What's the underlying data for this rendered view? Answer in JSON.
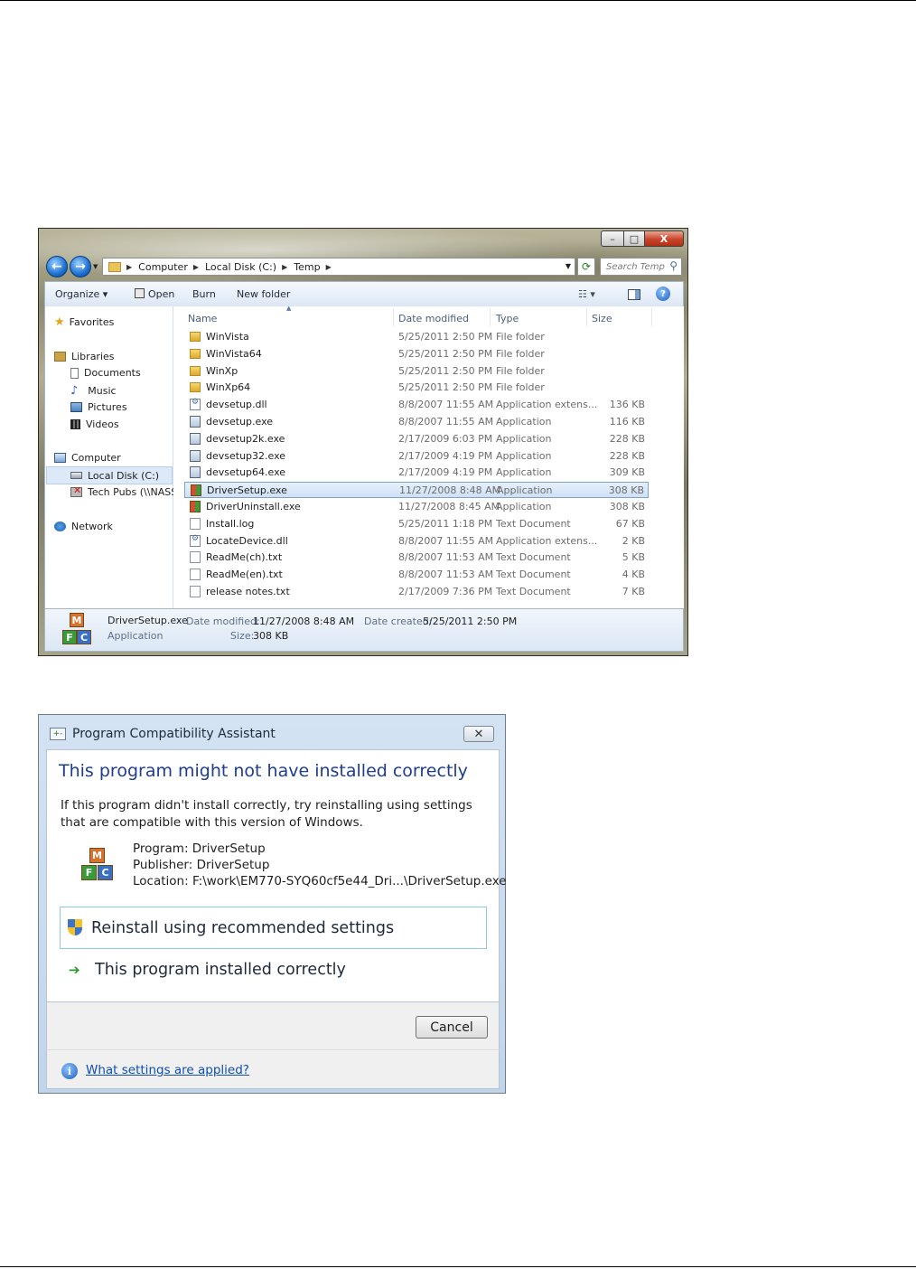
{
  "explorer": {
    "window_controls": {
      "minimize": "–",
      "maximize": "□",
      "close": "X"
    },
    "address": {
      "crumbs": [
        "Computer",
        "Local Disk (C:)",
        "Temp"
      ],
      "search_placeholder": "Search Temp"
    },
    "toolbar": {
      "organize": "Organize ▾",
      "open": "Open",
      "burn": "Burn",
      "new_folder": "New folder"
    },
    "nav": {
      "favorites": "Favorites",
      "libraries": "Libraries",
      "documents": "Documents",
      "music": "Music",
      "pictures": "Pictures",
      "videos": "Videos",
      "computer": "Computer",
      "local_disk": "Local Disk (C:)",
      "tech_pubs": "Tech Pubs (\\\\NASSE",
      "network": "Network"
    },
    "columns": {
      "name": "Name",
      "date": "Date modified",
      "type": "Type",
      "size": "Size"
    },
    "files": [
      {
        "name": "WinVista",
        "date": "5/25/2011 2:50 PM",
        "type": "File folder",
        "size": "",
        "icon": "folder-icon"
      },
      {
        "name": "WinVista64",
        "date": "5/25/2011 2:50 PM",
        "type": "File folder",
        "size": "",
        "icon": "folder-icon"
      },
      {
        "name": "WinXp",
        "date": "5/25/2011 2:50 PM",
        "type": "File folder",
        "size": "",
        "icon": "folder-icon"
      },
      {
        "name": "WinXp64",
        "date": "5/25/2011 2:50 PM",
        "type": "File folder",
        "size": "",
        "icon": "folder-icon"
      },
      {
        "name": "devsetup.dll",
        "date": "8/8/2007 11:55 AM",
        "type": "Application extens...",
        "size": "136 KB",
        "icon": "dll-icon"
      },
      {
        "name": "devsetup.exe",
        "date": "8/8/2007 11:55 AM",
        "type": "Application",
        "size": "116 KB",
        "icon": "exe-icon"
      },
      {
        "name": "devsetup2k.exe",
        "date": "2/17/2009 6:03 PM",
        "type": "Application",
        "size": "228 KB",
        "icon": "exe-icon"
      },
      {
        "name": "devsetup32.exe",
        "date": "2/17/2009 4:19 PM",
        "type": "Application",
        "size": "228 KB",
        "icon": "exe-icon"
      },
      {
        "name": "devsetup64.exe",
        "date": "2/17/2009 4:19 PM",
        "type": "Application",
        "size": "309 KB",
        "icon": "exe-icon"
      },
      {
        "name": "DriverSetup.exe",
        "date": "11/27/2008 8:48 AM",
        "type": "Application",
        "size": "308 KB",
        "icon": "setup-icon",
        "selected": true
      },
      {
        "name": "DriverUninstall.exe",
        "date": "11/27/2008 8:45 AM",
        "type": "Application",
        "size": "308 KB",
        "icon": "setup-icon"
      },
      {
        "name": "Install.log",
        "date": "5/25/2011 1:18 PM",
        "type": "Text Document",
        "size": "67 KB",
        "icon": "text-file-icon"
      },
      {
        "name": "LocateDevice.dll",
        "date": "8/8/2007 11:55 AM",
        "type": "Application extens...",
        "size": "2 KB",
        "icon": "dll-icon"
      },
      {
        "name": "ReadMe(ch).txt",
        "date": "8/8/2007 11:53 AM",
        "type": "Text Document",
        "size": "5 KB",
        "icon": "text-file-icon"
      },
      {
        "name": "ReadMe(en).txt",
        "date": "8/8/2007 11:53 AM",
        "type": "Text Document",
        "size": "4 KB",
        "icon": "text-file-icon"
      },
      {
        "name": "release notes.txt",
        "date": "2/17/2009 7:36 PM",
        "type": "Text Document",
        "size": "7 KB",
        "icon": "text-file-icon"
      }
    ],
    "details": {
      "filename": "DriverSetup.exe",
      "type": "Application",
      "date_modified_label": "Date modified:",
      "date_modified": "11/27/2008 8:48 AM",
      "date_created_label": "Date created:",
      "date_created": "5/25/2011 2:50 PM",
      "size_label": "Size:",
      "size": "308 KB"
    }
  },
  "dialog": {
    "title": "Program Compatibility Assistant",
    "heading": "This program might not have installed correctly",
    "body": "If this program didn't install correctly, try reinstalling using settings that are compatible with this version of Windows.",
    "program": "Program: DriverSetup",
    "publisher": "Publisher: DriverSetup",
    "location": "Location: F:\\work\\EM770-SYQ60cf5e44_Dri...\\DriverSetup.exe",
    "reinstall": "Reinstall using recommended settings",
    "installed_correctly": "This program installed correctly",
    "cancel": "Cancel",
    "help_link": "What settings are applied?"
  }
}
